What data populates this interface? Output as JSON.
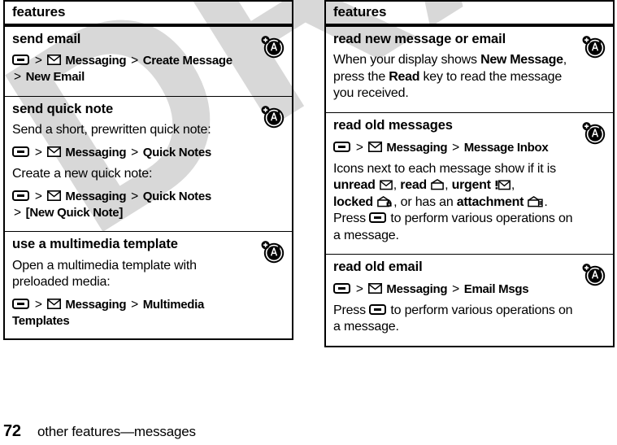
{
  "document": {
    "page_number": "72",
    "footer_text": "other features—messages",
    "watermark": "DRAFT",
    "watermark_color": "#d8d8d8"
  },
  "left_column": {
    "header": "features",
    "rows": [
      {
        "title": "send email",
        "badge": "antenna-a-icon",
        "blocks": [
          {
            "kind": "path",
            "segments": [
              "Messaging",
              "Create Message",
              "New Email"
            ],
            "text": "⊟ > ✉ Messaging > Create Message > New Email"
          }
        ]
      },
      {
        "title": "send quick note",
        "badge": "antenna-a-icon",
        "blocks": [
          {
            "kind": "para",
            "text": "Send a short, prewritten quick note:"
          },
          {
            "kind": "path",
            "segments": [
              "Messaging",
              "Quick Notes"
            ],
            "text": "⊟ > ✉ Messaging > Quick Notes"
          },
          {
            "kind": "para",
            "text": "Create a new quick note:"
          },
          {
            "kind": "path",
            "segments": [
              "Messaging",
              "Quick Notes",
              "[New Quick Note]"
            ],
            "text": "⊟ > ✉ Messaging > Quick Notes > [New Quick Note]"
          }
        ]
      },
      {
        "title": "use a multimedia template",
        "badge": "antenna-a-icon",
        "blocks": [
          {
            "kind": "para",
            "text": "Open a multimedia template with preloaded media:"
          },
          {
            "kind": "path",
            "segments": [
              "Messaging",
              "Multimedia Templates"
            ],
            "text": "⊟ > ✉ Messaging > Multimedia Templates"
          }
        ]
      }
    ]
  },
  "right_column": {
    "header": "features",
    "rows": [
      {
        "title": "read new message or email",
        "badge": "antenna-a-icon",
        "body_lead": "When your display shows ",
        "body_bold_1": "New Message",
        "body_mid": ", press the ",
        "body_bold_2": "Read",
        "body_tail": " key to read the message you received."
      },
      {
        "title": "read old messages",
        "badge": "antenna-a-icon",
        "path_segments": [
          "Messaging",
          "Message Inbox"
        ],
        "path_text": "⊟ > ✉ Messaging > Message Inbox",
        "icons_lead": "Icons next to each message show if it is ",
        "status_unread": "unread",
        "status_read": "read",
        "status_urgent": "urgent",
        "status_locked": "locked",
        "status_or": ", or has an ",
        "status_attachment": "attachment",
        "press_lead": "Press ",
        "press_tail": " to perform various operations on a message."
      },
      {
        "title": "read old email",
        "badge": "antenna-a-icon",
        "path_segments": [
          "Messaging",
          "Email Msgs"
        ],
        "path_text": "⊟ > ✉ Messaging > Email Msgs",
        "press_lead": "Press ",
        "press_tail": " to perform various operations on a message."
      }
    ]
  },
  "icons": {
    "menu_key": "menu-key-icon",
    "envelope": "envelope-icon",
    "unread": "envelope-closed-icon",
    "read": "envelope-open-icon",
    "urgent": "envelope-urgent-icon",
    "locked": "envelope-locked-icon",
    "attachment": "envelope-attachment-icon",
    "badge": "antenna-a-icon"
  }
}
